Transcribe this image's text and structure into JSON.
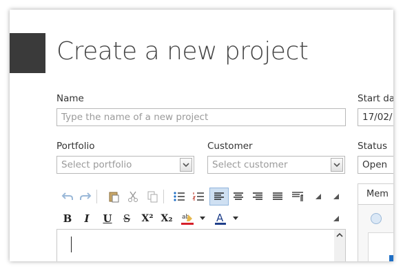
{
  "page": {
    "title": "Create a new project"
  },
  "fields": {
    "name": {
      "label": "Name",
      "placeholder": "Type the name of a new project"
    },
    "start_date": {
      "label": "Start da",
      "value": "17/02/"
    },
    "portfolio": {
      "label": "Portfolio",
      "placeholder": "Select portfolio"
    },
    "customer": {
      "label": "Customer",
      "placeholder": "Select customer"
    },
    "status": {
      "label": "Status",
      "value": "Open"
    }
  },
  "toolbar": {
    "icons": {
      "format_font_color_letter": "A",
      "bold": "B",
      "italic": "I",
      "underline": "U",
      "strikethrough": "S",
      "superscript": "X²",
      "subscript": "X₂"
    }
  },
  "tabs": [
    {
      "label": "Mem"
    }
  ],
  "colors": {
    "logo": "#3a3a3a",
    "accent": "#1f6fc5",
    "active_button": "#cfe0f2"
  }
}
